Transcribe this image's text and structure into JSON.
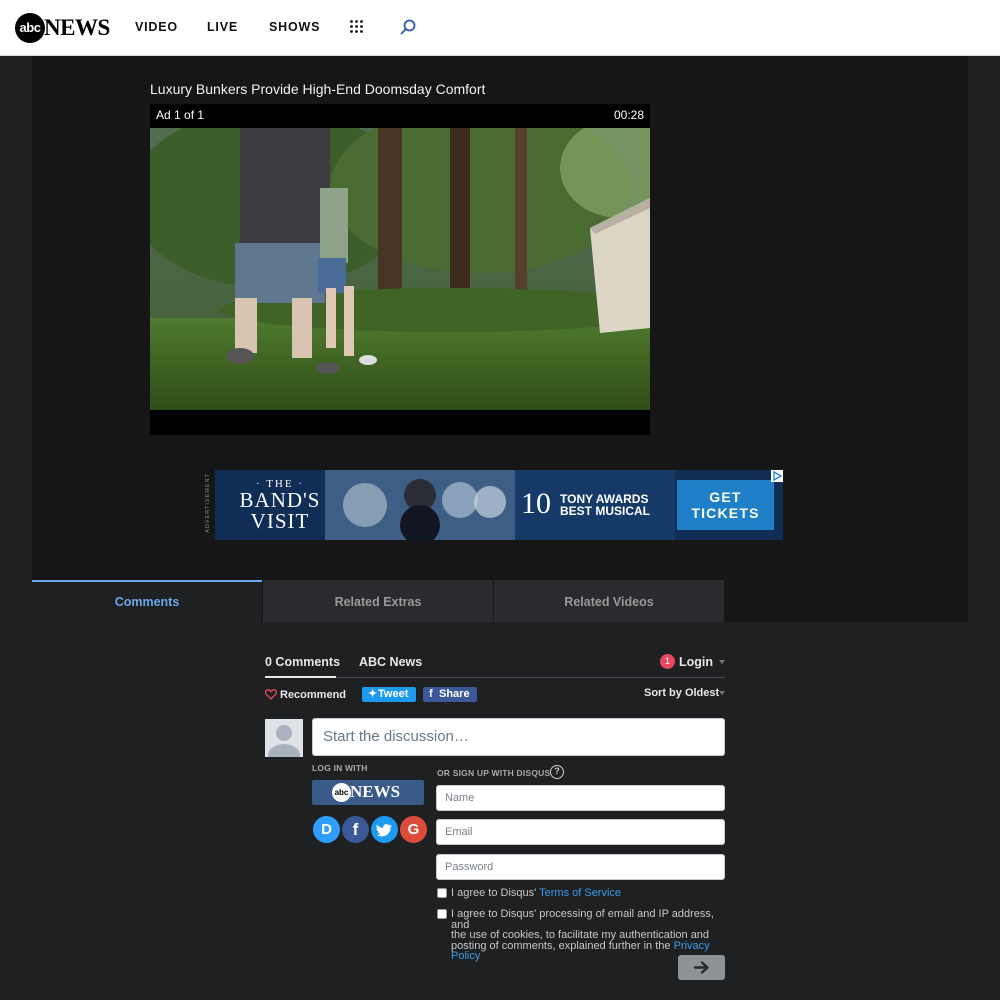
{
  "header": {
    "logo": {
      "circle_text": "abc",
      "word_text": "NEWS"
    },
    "nav": [
      {
        "label": "VIDEO"
      },
      {
        "label": "LIVE"
      },
      {
        "label": "SHOWS"
      }
    ],
    "icons": {
      "apps": "apps-grid-icon",
      "search": "search-icon"
    }
  },
  "video": {
    "title": "Luxury Bunkers Provide High-End Doomsday Comfort",
    "ad_label": "Ad 1 of 1",
    "ad_time": "00:28"
  },
  "ad_banner": {
    "vertical_label": "ADVERTISEMENT",
    "the": "· THE ·",
    "title_line1": "BAND'S",
    "title_line2": "VISIT",
    "ten": "10",
    "awards_line1": "TONY AWARDS",
    "awards_line2": "BEST MUSICAL",
    "button_line1": "GET",
    "button_line2": "TICKETS"
  },
  "tabs": [
    {
      "label": "Comments",
      "active": true
    },
    {
      "label": "Related Extras",
      "active": false
    },
    {
      "label": "Related Videos",
      "active": false
    }
  ],
  "disqus": {
    "comments_count_label": "0 Comments",
    "forum_name": "ABC News",
    "login_badge": "1",
    "login_label": "Login",
    "recommend_label": "Recommend",
    "tweet_label": "Tweet",
    "share_label": "Share",
    "sort_label": "Sort by Oldest",
    "start_placeholder": "Start the discussion…",
    "log_in_with": "LOG IN WITH",
    "sign_up_with": "OR SIGN UP WITH DISQUS",
    "help_glyph": "?",
    "abc_login": {
      "circle_text": "abc",
      "word_text": "NEWS"
    },
    "social": [
      {
        "name": "disqus",
        "glyph": "D",
        "color": "#2e9fff"
      },
      {
        "name": "facebook",
        "glyph": "f",
        "color": "#3b5998"
      },
      {
        "name": "twitter",
        "glyph": "t",
        "color": "#1d9bf0"
      },
      {
        "name": "google",
        "glyph": "G",
        "color": "#dd4b39"
      }
    ],
    "name_placeholder": "Name",
    "email_placeholder": "Email",
    "password_placeholder": "Password",
    "tos_prefix": "I agree to Disqus' ",
    "tos_link": "Terms of Service",
    "privacy_line1": "I agree to Disqus' processing of email and IP address, and",
    "privacy_line2": "the use of cookies, to facilitate my authentication and",
    "privacy_line3": "posting of comments, explained further in the ",
    "privacy_link": "Privacy Policy"
  },
  "colors": {
    "accent_blue": "#6aa8e8",
    "link_blue": "#3d9be9",
    "page_bg": "#1f2022",
    "panel_bg": "#161616"
  }
}
